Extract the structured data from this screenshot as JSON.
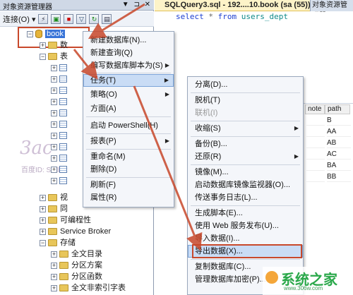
{
  "object_explorer": {
    "title": "对象资源管理器",
    "title_controls": "▼ ⊐ ✕",
    "toolbar": {
      "connect_label": "连接(O) ▾"
    },
    "db_name": "book",
    "tree": [
      {
        "label": "数",
        "kind": "folder"
      },
      {
        "label": "表",
        "kind": "folder"
      },
      {
        "label": "",
        "kind": "table"
      },
      {
        "label": "",
        "kind": "table"
      },
      {
        "label": "",
        "kind": "table"
      },
      {
        "label": "",
        "kind": "table"
      },
      {
        "label": "",
        "kind": "table"
      },
      {
        "label": "",
        "kind": "table"
      },
      {
        "label": "",
        "kind": "table"
      },
      {
        "label": "",
        "kind": "table"
      },
      {
        "label": "",
        "kind": "table"
      },
      {
        "label": "",
        "kind": "table"
      },
      {
        "label": "",
        "kind": "table"
      },
      {
        "label": "视",
        "kind": "folder"
      },
      {
        "label": "同",
        "kind": "folder"
      },
      {
        "label": "可编程性",
        "kind": "folder"
      },
      {
        "label": "Service Broker",
        "kind": "folder"
      },
      {
        "label": "存储",
        "kind": "folder"
      },
      {
        "label": "全文目录",
        "kind": "folder"
      },
      {
        "label": "分区方案",
        "kind": "folder"
      },
      {
        "label": "分区函数",
        "kind": "folder"
      },
      {
        "label": "全文非索引字表",
        "kind": "folder"
      }
    ],
    "watermark_text": "百度ID: Sallbitt"
  },
  "query_tab": {
    "title": "SQLQuery3.sql - 192....10.book (sa (55))*",
    "side_tab": "对象资源管理器"
  },
  "query_text": {
    "select": "select",
    "star": "*",
    "from": "from",
    "table": "users_dept"
  },
  "results": {
    "headers": [
      "note",
      "path"
    ],
    "rows": [
      [
        "",
        "B"
      ],
      [
        "",
        "AA"
      ],
      [
        "",
        "AB"
      ],
      [
        "",
        "AC"
      ],
      [
        "",
        "BA"
      ],
      [
        "",
        "BB"
      ]
    ]
  },
  "context_menu": {
    "items": [
      {
        "label": "新建数据库(N)...",
        "arrow": false
      },
      {
        "label": "新建查询(Q)",
        "arrow": false
      },
      {
        "label": "编写数据库脚本为(S)",
        "arrow": true
      },
      {
        "label": "任务(T)",
        "arrow": true,
        "highlighted": true
      },
      {
        "label": "策略(O)",
        "arrow": true
      },
      {
        "label": "方面(A)",
        "arrow": false
      },
      {
        "label": "启动 PowerShell(H)",
        "arrow": false
      },
      {
        "label": "报表(P)",
        "arrow": true
      },
      {
        "label": "重命名(M)",
        "arrow": false
      },
      {
        "label": "删除(D)",
        "arrow": false
      },
      {
        "label": "刷新(F)",
        "arrow": false
      },
      {
        "label": "属性(R)",
        "arrow": false
      }
    ]
  },
  "tasks_menu": {
    "items": [
      {
        "label": "分离(D)...",
        "arrow": false
      },
      {
        "label": "脱机(T)",
        "arrow": false
      },
      {
        "label": "联机(I)",
        "arrow": false,
        "disabled": true
      },
      {
        "label": "收缩(S)",
        "arrow": true
      },
      {
        "label": "备份(B)...",
        "arrow": false
      },
      {
        "label": "还原(R)",
        "arrow": true
      },
      {
        "label": "镜像(M)...",
        "arrow": false
      },
      {
        "label": "启动数据库镜像监视器(O)...",
        "arrow": false
      },
      {
        "label": "传送事务日志(L)...",
        "arrow": false
      },
      {
        "label": "生成脚本(E)...",
        "arrow": false
      },
      {
        "label": "使用 Web 服务发布(U)...",
        "arrow": false
      },
      {
        "label": "导入数据(I)...",
        "arrow": false
      },
      {
        "label": "导出数据(X)...",
        "arrow": false,
        "highlighted": true
      },
      {
        "label": "复制数据库(C)...",
        "arrow": false
      },
      {
        "label": "管理数据库加密(P)...",
        "arrow": false
      }
    ]
  },
  "corner_logo": {
    "text": "系统之家",
    "url": "www.306w.com"
  },
  "colors": {
    "highlight_border": "#c8482b",
    "selection_blue": "#3874d8",
    "menu_hover": "#c9dcf5"
  }
}
